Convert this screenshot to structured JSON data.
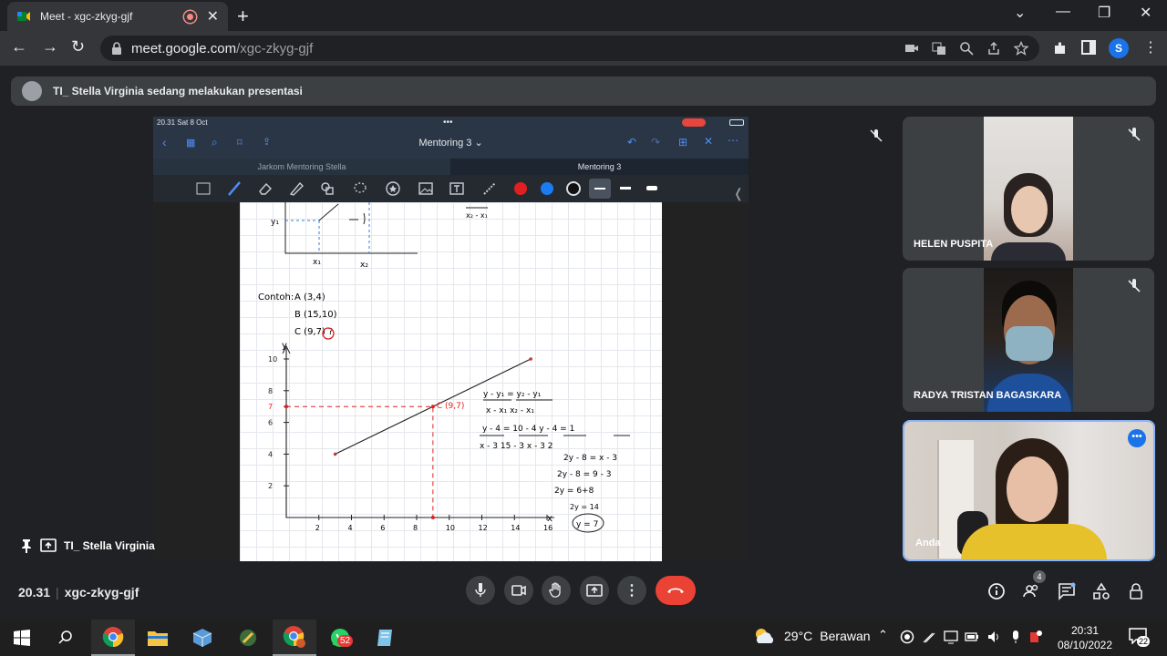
{
  "browser": {
    "tab_title": "Meet - xgc-zkyg-gjf",
    "url_host": "meet.google.com",
    "url_path": "/xgc-zkyg-gjf",
    "profile_initial": "S"
  },
  "meet": {
    "presentation_banner": "TI_ Stella Virginia sedang melakukan presentasi",
    "presenter_label": "TI_ Stella Virginia",
    "participants": [
      {
        "name": "HELEN PUSPITA",
        "muted": true
      },
      {
        "name": "RADYA TRISTAN BAGASKARA",
        "muted": true
      },
      {
        "name": "Anda",
        "muted": false
      }
    ],
    "time": "20.31",
    "meeting_code": "xgc-zkyg-gjf",
    "people_count": "4",
    "colors": {
      "end_call": "#ea4335",
      "self_border": "#8ab4f8",
      "accent": "#1a73e8"
    }
  },
  "ipad": {
    "status_time": "20.31  Sat 8 Oct",
    "doc_title": "Mentoring 3 ⌄",
    "tabs": [
      "Jarkom Mentoring Stella",
      "Mentoring 3"
    ],
    "ink_colors": [
      "#e02020",
      "#1a7cf0",
      "#111111"
    ],
    "notes": {
      "axis_labels_top": [
        "y₁",
        "x₁",
        "x₂"
      ],
      "contoh": "Contoh:",
      "points": [
        "A (3,4)",
        "B (15,10)",
        "C (9,7) ?"
      ],
      "y_ticks": [
        "10",
        "8",
        "7",
        "6",
        "4",
        "2"
      ],
      "x_ticks": [
        "2",
        "4",
        "6",
        "8",
        "10",
        "12",
        "14",
        "16"
      ],
      "axis_y": "y",
      "axis_x": "x",
      "point_c_label": "C (9,7)",
      "formula1": "y - y₁ / x - x₁ = x₂ - x₁ / y₂ - y₁",
      "working": [
        "y-4 / x-3 = 10-4 / 15-3",
        "y - 4 / x - 3 = 6/12 = 1/2",
        "2y - 8 = x - 3",
        "2y - 8 = 9 - 3",
        "2y = 6+8",
        "2y = 14",
        "y = 7"
      ],
      "chart_data": {
        "type": "line",
        "x": [
          3,
          15
        ],
        "y": [
          4,
          10
        ],
        "xlim": [
          0,
          16
        ],
        "ylim": [
          0,
          10
        ],
        "highlight": {
          "x": 9,
          "y": 7
        }
      }
    }
  },
  "taskbar": {
    "weather_temp": "29°C",
    "weather_text": "Berawan",
    "clock_time": "20:31",
    "clock_date": "08/10/2022",
    "whatsapp_badge": "52",
    "notification_count": "22"
  }
}
